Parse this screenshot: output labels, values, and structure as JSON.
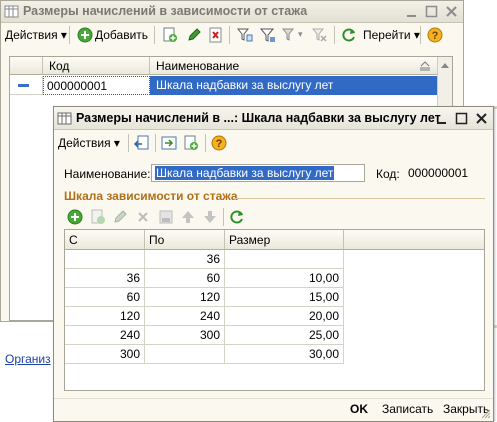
{
  "back_window": {
    "title": "Размеры начислений в зависимости от стажа",
    "toolbar": {
      "actions_label": "Действия",
      "add_label": "Добавить",
      "goto_label": "Перейти"
    },
    "grid": {
      "columns": [
        "Код",
        "Наименование"
      ],
      "rows": [
        {
          "code": "000000001",
          "name": "Шкала надбавки за выслугу лет"
        }
      ]
    },
    "bottom_link": "Организ"
  },
  "dialog": {
    "title": "Размеры начислений в ...: Шкала надбавки за выслугу лет",
    "toolbar": {
      "actions_label": "Действия"
    },
    "form": {
      "name_label": "Наименование:",
      "name_value": "Шкала надбавки за выслугу лет",
      "code_label": "Код:",
      "code_value": "000000001"
    },
    "section_title": "Шкала зависимости от стажа",
    "scale_table": {
      "columns": [
        "С",
        "По",
        "Размер"
      ],
      "rows": [
        {
          "from": "",
          "to": "36",
          "size": ""
        },
        {
          "from": "36",
          "to": "60",
          "size": "10,00"
        },
        {
          "from": "60",
          "to": "120",
          "size": "15,00"
        },
        {
          "from": "120",
          "to": "240",
          "size": "20,00"
        },
        {
          "from": "240",
          "to": "300",
          "size": "25,00"
        },
        {
          "from": "300",
          "to": "",
          "size": "30,00"
        }
      ]
    },
    "buttons": {
      "ok": "OK",
      "save": "Записать",
      "close": "Закрыть"
    }
  },
  "colors": {
    "selection": "#316ac5",
    "section_title": "#b07018",
    "link": "#1b40a8"
  }
}
